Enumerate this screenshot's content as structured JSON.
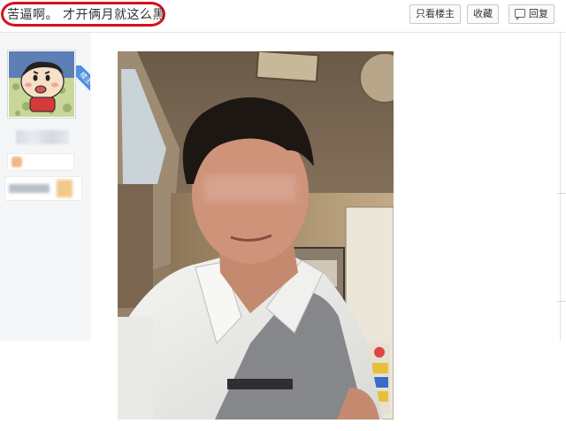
{
  "post": {
    "title": "苦逼啊。 才开俩月就这么黑"
  },
  "toolbar": {
    "only_op_label": "只看楼主",
    "favorite_label": "收藏",
    "reply_label": "回复",
    "reply_icon": "reply-icon"
  },
  "user": {
    "op_badge_label": "楼主",
    "avatar_icon": "avatar-cartoon"
  },
  "colors": {
    "highlight_circle": "#d8101a",
    "op_badge": "#4f8fe0",
    "panel_bg": "#f5f6f8"
  }
}
